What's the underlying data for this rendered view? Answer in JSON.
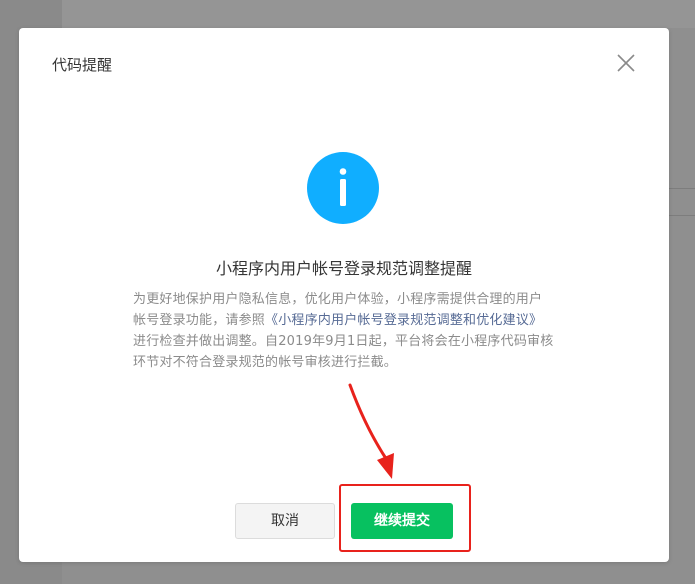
{
  "dialog": {
    "title": "代码提醒",
    "close_icon": "close-icon"
  },
  "notice": {
    "icon": "info-icon",
    "title": "小程序内用户帐号登录规范调整提醒",
    "body_part1": "为更好地保护用户隐私信息，优化用户体验，小程序需提供合理的用户帐号登录功能，请参照",
    "body_link": "《小程序内用户帐号登录规范调整和优化建议》",
    "body_part2": "进行检查并做出调整。自2019年9月1日起，平台将会在小程序代码审核环节对不符合登录规范的帐号审核进行拦截。"
  },
  "actions": {
    "cancel_label": "取消",
    "continue_label": "继续提交"
  },
  "colors": {
    "primary_green": "#07c160",
    "info_blue": "#10aeff",
    "link_blue": "#576b95",
    "annotation_red": "#e8221c"
  }
}
